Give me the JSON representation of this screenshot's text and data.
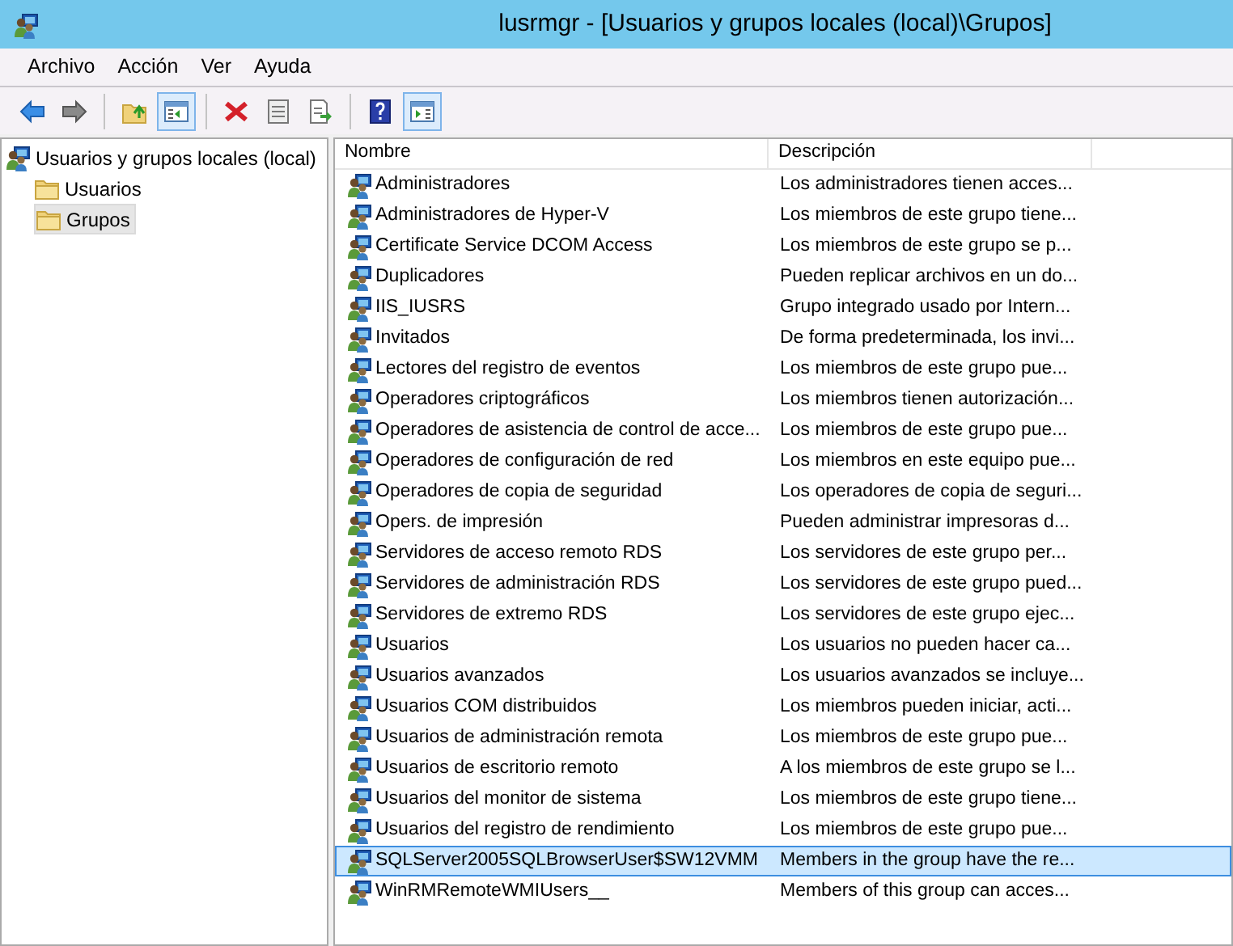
{
  "window": {
    "title": "lusrmgr - [Usuarios y grupos locales (local)\\Grupos]"
  },
  "menu": [
    "Archivo",
    "Acción",
    "Ver",
    "Ayuda"
  ],
  "toolbar": [
    {
      "kind": "back",
      "pressed": false
    },
    {
      "kind": "forward",
      "pressed": false
    },
    {
      "kind": "separator"
    },
    {
      "kind": "up",
      "pressed": false
    },
    {
      "kind": "tree",
      "pressed": true
    },
    {
      "kind": "separator"
    },
    {
      "kind": "delete",
      "pressed": false
    },
    {
      "kind": "properties",
      "pressed": false
    },
    {
      "kind": "export",
      "pressed": false
    },
    {
      "kind": "separator"
    },
    {
      "kind": "help",
      "pressed": false
    },
    {
      "kind": "actions",
      "pressed": true
    }
  ],
  "tree": {
    "label": "Usuarios y grupos locales (local)",
    "children": [
      {
        "label": "Usuarios",
        "selected": false
      },
      {
        "label": "Grupos",
        "selected": true
      }
    ]
  },
  "table": {
    "columns": [
      "Nombre",
      "Descripción"
    ],
    "rows": [
      {
        "name": "Administradores",
        "description": "Los administradores tienen acces...",
        "selected": false
      },
      {
        "name": "Administradores de Hyper-V",
        "description": "Los miembros de este grupo tiene...",
        "selected": false
      },
      {
        "name": "Certificate Service DCOM Access",
        "description": "Los miembros de este grupo se p...",
        "selected": false
      },
      {
        "name": "Duplicadores",
        "description": "Pueden replicar archivos en un do...",
        "selected": false
      },
      {
        "name": "IIS_IUSRS",
        "description": "Grupo integrado usado por Intern...",
        "selected": false
      },
      {
        "name": "Invitados",
        "description": "De forma predeterminada, los invi...",
        "selected": false
      },
      {
        "name": "Lectores del registro de eventos",
        "description": "Los miembros de este grupo pue...",
        "selected": false
      },
      {
        "name": "Operadores criptográficos",
        "description": "Los miembros tienen autorización...",
        "selected": false
      },
      {
        "name": "Operadores de asistencia de control de acce...",
        "description": "Los miembros de este grupo pue...",
        "selected": false
      },
      {
        "name": "Operadores de configuración de red",
        "description": "Los miembros en este equipo pue...",
        "selected": false
      },
      {
        "name": "Operadores de copia de seguridad",
        "description": "Los operadores de copia de seguri...",
        "selected": false
      },
      {
        "name": "Opers. de impresión",
        "description": "Pueden administrar impresoras d...",
        "selected": false
      },
      {
        "name": "Servidores de acceso remoto RDS",
        "description": "Los servidores de este grupo per...",
        "selected": false
      },
      {
        "name": "Servidores de administración RDS",
        "description": "Los servidores de este grupo pued...",
        "selected": false
      },
      {
        "name": "Servidores de extremo RDS",
        "description": "Los servidores de este grupo ejec...",
        "selected": false
      },
      {
        "name": "Usuarios",
        "description": "Los usuarios no pueden hacer ca...",
        "selected": false
      },
      {
        "name": "Usuarios avanzados",
        "description": "Los usuarios avanzados se incluye...",
        "selected": false
      },
      {
        "name": "Usuarios COM distribuidos",
        "description": "Los miembros pueden iniciar, acti...",
        "selected": false
      },
      {
        "name": "Usuarios de administración remota",
        "description": "Los miembros de este grupo pue...",
        "selected": false
      },
      {
        "name": "Usuarios de escritorio remoto",
        "description": "A los miembros de este grupo se l...",
        "selected": false
      },
      {
        "name": "Usuarios del monitor de sistema",
        "description": "Los miembros de este grupo tiene...",
        "selected": false
      },
      {
        "name": "Usuarios del registro de rendimiento",
        "description": "Los miembros de este grupo pue...",
        "selected": false
      },
      {
        "name": "SQLServer2005SQLBrowserUser$SW12VMM",
        "description": "Members in the group have the re...",
        "selected": true
      },
      {
        "name": "WinRMRemoteWMIUsers__",
        "description": "Members of this group can acces...",
        "selected": false
      }
    ]
  }
}
